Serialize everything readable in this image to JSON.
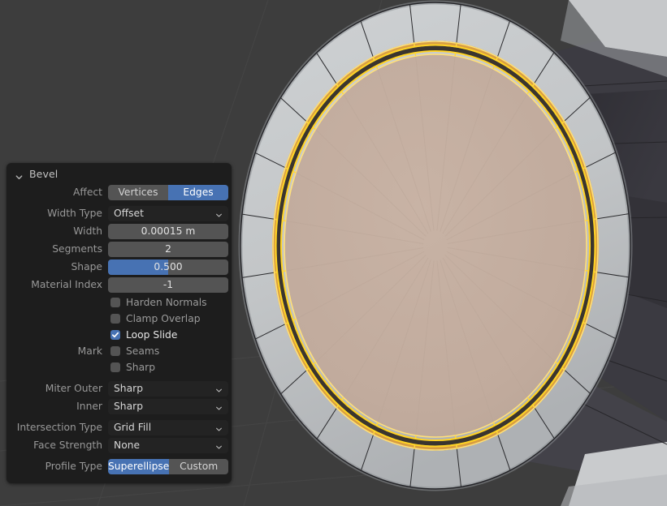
{
  "viewport": {
    "name": "3d-viewport",
    "background_color": "#3d3d3d",
    "grid_color": "#454545",
    "mesh": {
      "description": "Edit-mode cylinder end cap with bevelled rim, viewed face-on",
      "outer_ring_color": "#c3c6c8",
      "outer_ring_shadow_color": "#9a9da0",
      "inner_disc_color": "#c2ac9e",
      "bevel_band_dark_color": "#3a352f",
      "bevel_band_amber_color": "#d99c3c",
      "selected_edge_color": "#ffd83b",
      "selected_edge_bright_color": "#ffe98a",
      "wire_color": "#2a2a2a",
      "body_dark_color": "#343339",
      "body_darker_color": "#2a292e",
      "body_light_color": "#c6c8ca",
      "ring_segments": 24
    }
  },
  "panel": {
    "title": "Bevel",
    "collapse_icon": "chevron-down-icon",
    "fields": {
      "affect": {
        "label": "Affect",
        "options": [
          "Vertices",
          "Edges"
        ],
        "selected": "Edges"
      },
      "width_type": {
        "label": "Width Type",
        "value": "Offset"
      },
      "width": {
        "label": "Width",
        "value": "0.00015 m"
      },
      "segments": {
        "label": "Segments",
        "value": "2"
      },
      "shape": {
        "label": "Shape",
        "value": "0.500",
        "fill_percent": 50
      },
      "material_index": {
        "label": "Material Index",
        "value": "-1"
      },
      "harden_normals": {
        "label": "Harden Normals",
        "checked": false
      },
      "clamp_overlap": {
        "label": "Clamp Overlap",
        "checked": false
      },
      "loop_slide": {
        "label": "Loop Slide",
        "checked": true
      },
      "mark": {
        "label": "Mark"
      },
      "seams": {
        "label": "Seams",
        "checked": false
      },
      "sharp": {
        "label": "Sharp",
        "checked": false
      },
      "miter_outer": {
        "label": "Miter Outer",
        "value": "Sharp"
      },
      "miter_inner": {
        "label": "Inner",
        "value": "Sharp"
      },
      "intersection_type": {
        "label": "Intersection Type",
        "value": "Grid Fill"
      },
      "face_strength": {
        "label": "Face Strength",
        "value": "None"
      },
      "profile_type": {
        "label": "Profile Type",
        "options": [
          "Superellipse",
          "Custom"
        ],
        "selected": "Superellipse"
      }
    },
    "colors": {
      "accent": "#4772b3",
      "field": "#545454",
      "dropdown": "#232323",
      "bg": "#1d1d1d"
    }
  }
}
